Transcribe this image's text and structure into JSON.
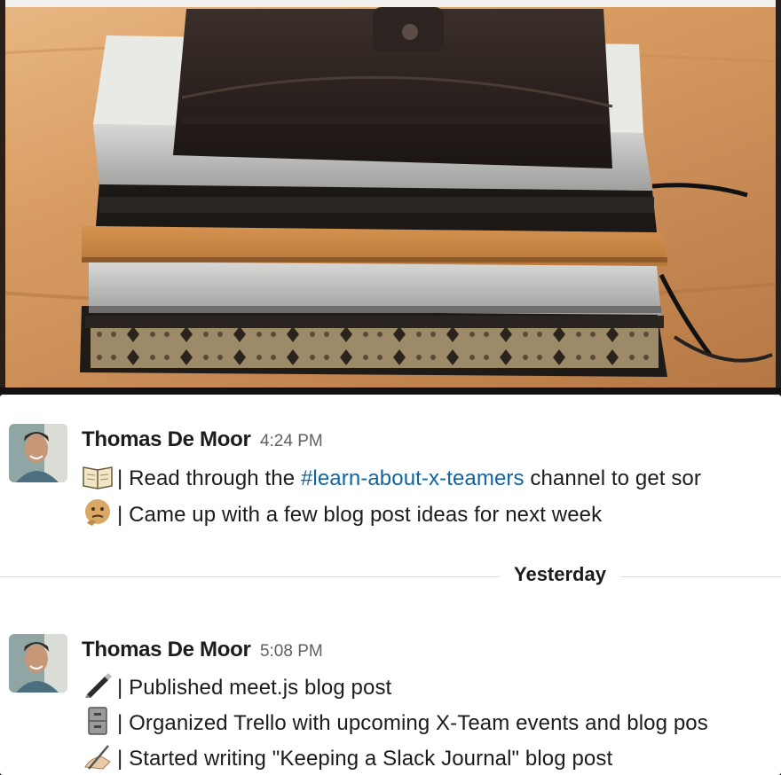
{
  "messages": [
    {
      "author": "Thomas De Moor",
      "time": "4:24 PM",
      "lines": [
        {
          "emoji": "open-book-icon",
          "prefix": "| Read through the ",
          "channel": "#learn-about-x-teamers",
          "suffix": " channel to get sor"
        },
        {
          "emoji": "thinking-face-icon",
          "text": "| Came up with a few blog post ideas for next week"
        }
      ]
    },
    {
      "author": "Thomas De Moor",
      "time": "5:08 PM",
      "lines": [
        {
          "emoji": "lower-left-fountain-pen-icon",
          "text": "| Published meet.js blog post"
        },
        {
          "emoji": "file-cabinet-icon",
          "text": "| Organized Trello with upcoming X-Team events and blog pos"
        },
        {
          "emoji": "writing-hand-icon",
          "text": "| Started writing \"Keeping a Slack Journal\" blog post"
        }
      ]
    }
  ],
  "day_divider": "Yesterday",
  "colors": {
    "channel_link": "#1264a3",
    "text": "#1d1c1d",
    "timestamp": "#616061"
  }
}
